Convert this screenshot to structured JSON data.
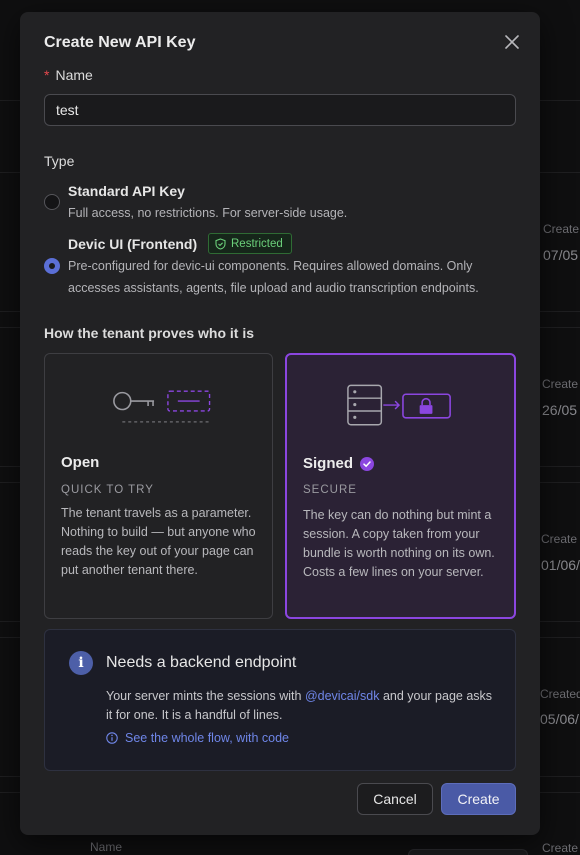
{
  "background": {
    "created_label": "Create",
    "column_label": "Created",
    "name_label": "Name",
    "dates": [
      "07/05",
      "26/05",
      "01/06/",
      "05/06/"
    ]
  },
  "modal": {
    "title": "Create New API Key",
    "name_field": {
      "required_mark": "*",
      "label": "Name",
      "value": "test"
    },
    "type_label": "Type",
    "options": [
      {
        "title": "Standard API Key",
        "description": "Full access, no restrictions. For server-side usage.",
        "selected": false
      },
      {
        "title": "Devic UI (Frontend)",
        "badge": "Restricted",
        "description_line1": "Pre-configured for devic-ui components. Requires allowed domains. Only",
        "description_line2": "accesses assistants, agents, file upload and audio transcription endpoints.",
        "selected": true
      }
    ],
    "proof_label": "How the tenant proves who it is",
    "cards": {
      "open": {
        "title": "Open",
        "subtitle": "QUICK TO TRY",
        "description": "The tenant travels as a parameter. Nothing to build — but anyone who reads the key out of your page can put another tenant there.",
        "selected": false
      },
      "signed": {
        "title": "Signed",
        "subtitle": "SECURE",
        "description": "The key can do nothing but mint a session. A copy taken from your bundle is worth nothing on its own. Costs a few lines on your server.",
        "selected": true
      }
    },
    "info": {
      "icon_glyph": "i",
      "title": "Needs a backend endpoint",
      "body_before": "Your server mints the sessions with ",
      "sdk": "@devicai/sdk",
      "body_after": " and your page asks it for one. It is a handful of lines.",
      "link": "See the whole flow, with code"
    },
    "buttons": {
      "cancel": "Cancel",
      "create": "Create"
    }
  },
  "colors": {
    "accent": "#4a5aa6",
    "selected_card_border": "#8b46e0",
    "badge_green": "#6bd07a",
    "link_blue": "#6f86e8"
  }
}
